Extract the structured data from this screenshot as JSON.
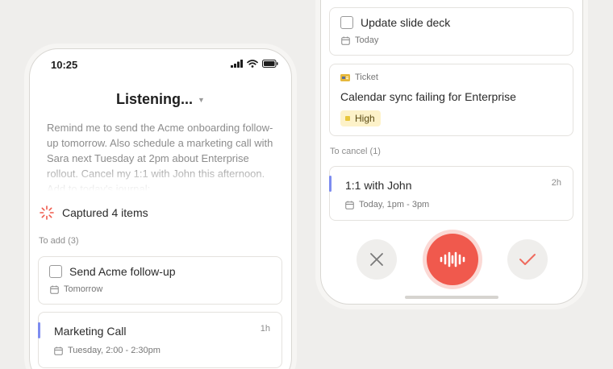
{
  "left_phone": {
    "status_time": "10:25",
    "listening_label": "Listening...",
    "transcript": "Remind me to send the Acme onboarding follow-up tomorrow. Also schedule a marketing call with Sara next Tuesday at 2pm about Enterprise rollout. Cancel my 1:1 with John this afternoon. Add to today's journal:",
    "captured_label": "Captured 4 items",
    "to_add_label": "To add (3)",
    "items": [
      {
        "title": "Send Acme follow-up",
        "meta": "Tomorrow"
      },
      {
        "title": "Marketing Call",
        "meta": "Tuesday, 2:00 - 2:30pm",
        "duration": "1h"
      }
    ]
  },
  "right_phone": {
    "task_card": {
      "title": "Update slide deck",
      "meta": "Today"
    },
    "ticket_card": {
      "type_label": "Ticket",
      "title": "Calendar sync failing for Enterprise",
      "priority": "High"
    },
    "to_cancel_label": "To cancel (1)",
    "cancel_card": {
      "title": "1:1 with John",
      "meta": "Today, 1pm - 3pm",
      "duration": "2h"
    }
  },
  "colors": {
    "background": "#efeeec",
    "record": "#f0594d",
    "accent": "#7d8cf0",
    "confirm": "#ef6b5e",
    "priority_chip": "#fdf2c9"
  },
  "icons": [
    "signal-icon",
    "wifi-icon",
    "battery-icon",
    "chevron-down-icon",
    "spinner-icon",
    "calendar-icon",
    "ticket-icon",
    "close-icon",
    "waveform-icon",
    "check-icon"
  ]
}
